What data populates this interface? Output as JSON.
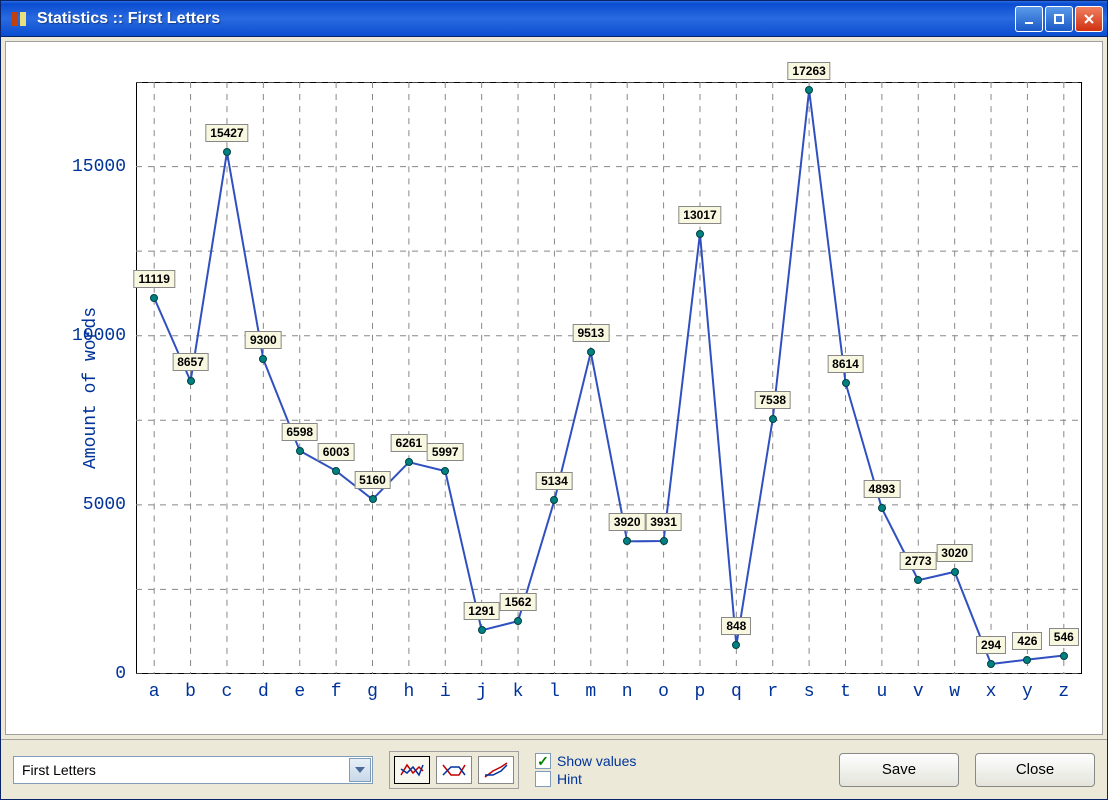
{
  "window": {
    "title": "Statistics :: First Letters"
  },
  "chart_data": {
    "type": "line",
    "title": "",
    "xlabel": "",
    "ylabel": "Amount of words",
    "ylim": [
      0,
      17500
    ],
    "yticks": [
      0,
      5000,
      10000,
      15000
    ],
    "categories": [
      "a",
      "b",
      "c",
      "d",
      "e",
      "f",
      "g",
      "h",
      "i",
      "j",
      "k",
      "l",
      "m",
      "n",
      "o",
      "p",
      "q",
      "r",
      "s",
      "t",
      "u",
      "v",
      "w",
      "x",
      "y",
      "z"
    ],
    "values": [
      11119,
      8657,
      15427,
      9300,
      6598,
      6003,
      5160,
      6261,
      5997,
      1291,
      1562,
      5134,
      9513,
      3920,
      3931,
      13017,
      848,
      7538,
      17263,
      8614,
      4893,
      2773,
      3020,
      294,
      426,
      546
    ]
  },
  "toolbar": {
    "dropdown_selected": "First Letters",
    "show_values_label": "Show values",
    "show_values_checked": true,
    "hint_label": "Hint",
    "hint_checked": false,
    "save_label": "Save",
    "close_label": "Close"
  }
}
